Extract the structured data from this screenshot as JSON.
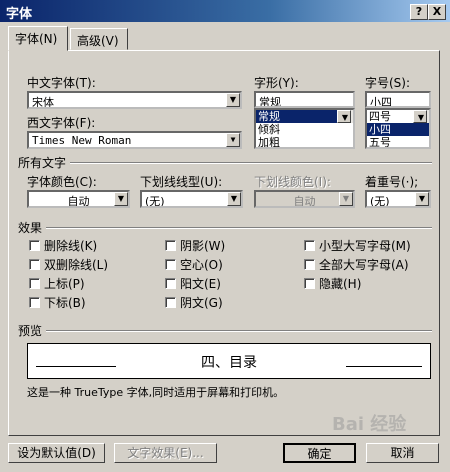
{
  "title": "字体",
  "titlebar_buttons": {
    "help": "?",
    "close": "X"
  },
  "tabs": [
    {
      "label": "字体(N)"
    },
    {
      "label": "高级(V)"
    }
  ],
  "chinese_font": {
    "label": "中文字体(T):",
    "value": "宋体"
  },
  "western_font": {
    "label": "西文字体(F):",
    "value": "Times New Roman"
  },
  "style": {
    "label": "字形(Y):",
    "value": "常规",
    "options": [
      "常规",
      "倾斜",
      "加粗"
    ],
    "selected_index": 0
  },
  "size": {
    "label": "字号(S):",
    "value": "小四",
    "options": [
      "四号",
      "小四",
      "五号"
    ],
    "selected_index": 1
  },
  "all_text": {
    "title": "所有文字",
    "font_color": {
      "label": "字体颜色(C):",
      "value": "自动"
    },
    "underline_type": {
      "label": "下划线线型(U):",
      "value": "(无)"
    },
    "underline_color": {
      "label": "下划线颜色(I):",
      "value": "自动"
    },
    "emphasis": {
      "label": "着重号(·);",
      "value": "(无)"
    }
  },
  "effects": {
    "title": "效果",
    "col1": [
      "删除线(K)",
      "双删除线(L)",
      "上标(P)",
      "下标(B)"
    ],
    "col2": [
      "阴影(W)",
      "空心(O)",
      "阳文(E)",
      "阴文(G)"
    ],
    "col3": [
      "小型大写字母(M)",
      "全部大写字母(A)",
      "隐藏(H)"
    ]
  },
  "preview": {
    "title": "预览",
    "sample": "四、目录",
    "note": "这是一种 TrueType 字体,同时适用于屏幕和打印机。"
  },
  "buttons": {
    "default": "设为默认值(D)",
    "text_effects": "文字效果(E)...",
    "ok": "确定",
    "cancel": "取消"
  },
  "watermark": "Bai 经验"
}
